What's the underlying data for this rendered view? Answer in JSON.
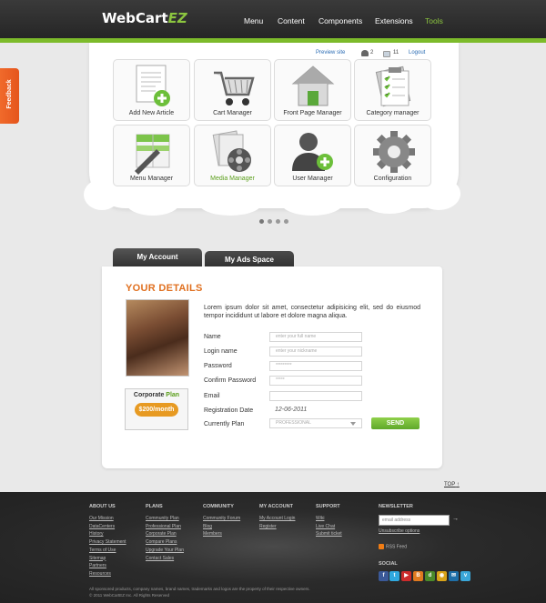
{
  "brand": {
    "name": "WebCart",
    "suffix": "EZ"
  },
  "nav": [
    {
      "label": "Menu",
      "active": false
    },
    {
      "label": "Content",
      "active": false
    },
    {
      "label": "Components",
      "active": false
    },
    {
      "label": "Extensions",
      "active": false
    },
    {
      "label": "Tools",
      "active": true
    }
  ],
  "toplinks": {
    "preview": "Preview site",
    "users_count": "2",
    "messages_count": "11",
    "logout": "Logout"
  },
  "feedback": "Feedback",
  "tiles": [
    {
      "label": "Add New Article",
      "icon": "add-article-icon",
      "active": false
    },
    {
      "label": "Cart Manager",
      "icon": "cart-icon",
      "active": false
    },
    {
      "label": "Front Page Manager",
      "icon": "home-icon",
      "active": false
    },
    {
      "label": "Category manager",
      "icon": "category-icon",
      "active": false
    },
    {
      "label": "Menu Manager",
      "icon": "menu-manager-icon",
      "active": false
    },
    {
      "label": "Media Manager",
      "icon": "media-icon",
      "active": true
    },
    {
      "label": "User Manager",
      "icon": "add-user-icon",
      "active": false
    },
    {
      "label": "Configuration",
      "icon": "gear-icon",
      "active": false
    }
  ],
  "tabs": {
    "account": "My Account",
    "ads": "My Ads Space"
  },
  "details": {
    "title": "YOUR DETAILS",
    "intro": "Lorem ipsum dolor sit amet, consectetur adipisicing elit, sed do eiusmod tempor incididunt ut labore et dolore magna aliqua.",
    "fields": {
      "name": {
        "label": "Name",
        "placeholder": "enter your full name"
      },
      "login": {
        "label": "Login name",
        "placeholder": "enter your nickname"
      },
      "password": {
        "label": "Password",
        "value": "*********"
      },
      "confirm": {
        "label": "Confirm Password",
        "value": "*****"
      },
      "email": {
        "label": "Email",
        "value": ""
      },
      "registration": {
        "label": "Registration Date",
        "value": "12-06-2011"
      },
      "plan": {
        "label": "Currently Plan",
        "value": "PROFESSIONAL"
      }
    },
    "send": "SEND",
    "plan_box": {
      "word1": "Corporate",
      "word2": "Plan",
      "price": "$200/month"
    }
  },
  "top_link": "TOP",
  "footer": {
    "columns": [
      {
        "heading": "ABOUT US",
        "links": [
          "Our Mission",
          "DataCenters",
          "History",
          "Privacy Statement",
          "Terms of Use",
          "Sitemap",
          "Partners",
          "Resources"
        ]
      },
      {
        "heading": "PLANS",
        "links": [
          "Community Plan",
          "Professional Plan",
          "Corporate Plan",
          "Compare Plans",
          "Upgrade Your Plan",
          "Contact Sales"
        ]
      },
      {
        "heading": "COMMUNITY",
        "links": [
          "Community Forum",
          "Blog",
          "Members"
        ]
      },
      {
        "heading": "MY ACCOUNT",
        "links": [
          "My Account Login",
          "Register"
        ]
      },
      {
        "heading": "SUPPORT",
        "links": [
          "Wiki",
          "Live Chat",
          "Submit ticket"
        ]
      }
    ],
    "newsletter": {
      "heading": "NEWSLETTER",
      "placeholder": "email address",
      "arrow": "→",
      "unsubscribe": "Unsubscribe options"
    },
    "rss": "RSS Feed",
    "social_heading": "SOCIAL",
    "social_icons": [
      {
        "name": "facebook-icon",
        "glyph": "f",
        "color": "#3b5998"
      },
      {
        "name": "twitter-icon",
        "glyph": "t",
        "color": "#2fa8df"
      },
      {
        "name": "youtube-icon",
        "glyph": "▶",
        "color": "#cc2b2b"
      },
      {
        "name": "blogger-icon",
        "glyph": "B",
        "color": "#e07a1f"
      },
      {
        "name": "delicious-icon",
        "glyph": "d",
        "color": "#4a8a2a"
      },
      {
        "name": "rss-share-icon",
        "glyph": "◉",
        "color": "#d8a319"
      },
      {
        "name": "digg-icon",
        "glyph": "✉",
        "color": "#1f6fa8"
      },
      {
        "name": "vimeo-icon",
        "glyph": "v",
        "color": "#3aa6d8"
      }
    ],
    "legal_1": "All sponsored products, company names, brand names, trademarks and logos are the property of their respective owners.",
    "legal_2": "2011 WebCartEZ Inc. All Rights Reserved"
  }
}
